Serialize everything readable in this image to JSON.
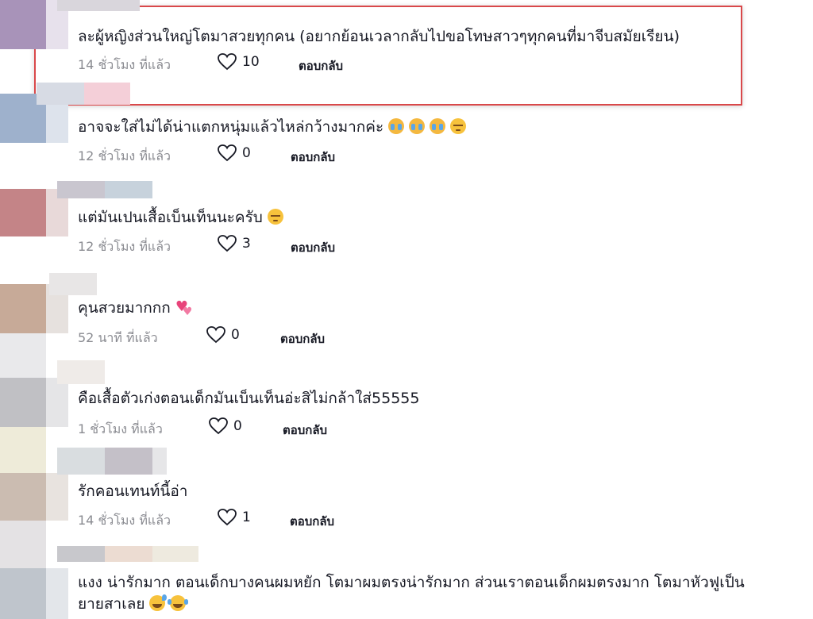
{
  "comments": [
    {
      "text": "ละผู้หญิงส่วนใหญ่โตมาสวยทุกคน (อยากย้อนเวลากลับไปขอโทษสาวๆทุกคนที่มาจีบสมัยเรียน)",
      "emojis": [],
      "time": "14 ชั่วโมง ที่แล้ว",
      "likes": "10",
      "reply": "ตอบกลับ",
      "highlighted": true
    },
    {
      "text": "อาจจะใส่ไม่ได้น่าแตกหนุ่มแล้วไหล่กว้างมากค่ะ",
      "emojis": [
        "cry-icon",
        "cry-icon",
        "cry-icon",
        "pensive-icon"
      ],
      "time": "12 ชั่วโมง ที่แล้ว",
      "likes": "0",
      "reply": "ตอบกลับ"
    },
    {
      "text": "แต่มันเปนเสื้อเบ็นเท็นนะครับ",
      "emojis": [
        "pensive-icon"
      ],
      "time": "12 ชั่วโมง ที่แล้ว",
      "likes": "3",
      "reply": "ตอบกลับ"
    },
    {
      "text": "คุนสวยมากกก",
      "emojis": [
        "two-hearts-icon"
      ],
      "time": "52 นาที ที่แล้ว",
      "likes": "0",
      "reply": "ตอบกลับ"
    },
    {
      "text": "คือเสื้อตัวเก่งตอนเด็กมันเบ็นเท็นอ่ะสิไม่กล้าใส่55555",
      "emojis": [],
      "time": "1 ชั่วโมง ที่แล้ว",
      "likes": "0",
      "reply": "ตอบกลับ"
    },
    {
      "text": "รักคอนเทนท์นี้อ่า",
      "emojis": [],
      "time": "14 ชั่วโมง ที่แล้ว",
      "likes": "1",
      "reply": "ตอบกลับ"
    },
    {
      "text_line1": "แงง น่ารักมาก ตอนเด็กบางคนผมหยัก โตมาผมตรงน่ารักมาก ส่วนเราตอนเด็กผมตรงมาก โตมาหัวฟูเป็น",
      "text_line2": "ยายสาเลย",
      "emojis": [
        "sweat-smile-icon",
        "joy-icon"
      ]
    }
  ],
  "colors": {
    "highlight_border": "#d9484a",
    "meta_text": "#8a8b91",
    "text": "#161823"
  }
}
